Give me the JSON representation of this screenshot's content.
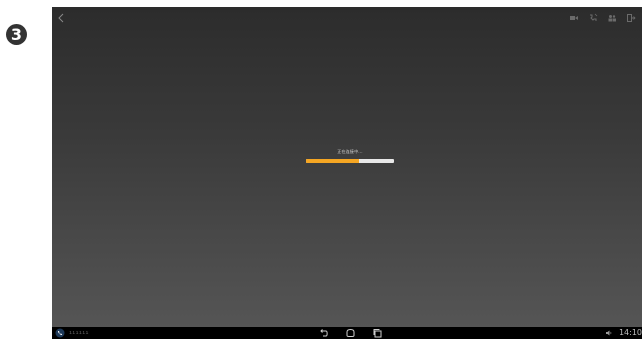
{
  "step_badge": "3",
  "top_icons": [
    "video-icon",
    "hangup-icon",
    "participants-icon",
    "exit-icon"
  ],
  "loading": {
    "message": "正在连接中...",
    "progress": 0.6,
    "fill_color": "#f5a623",
    "track_color": "#e8e8e8"
  },
  "status_bar": {
    "signal_dots": "ıııııı",
    "time": "14:10"
  },
  "nav_buttons": [
    "back-icon",
    "home-icon",
    "recents-icon"
  ]
}
